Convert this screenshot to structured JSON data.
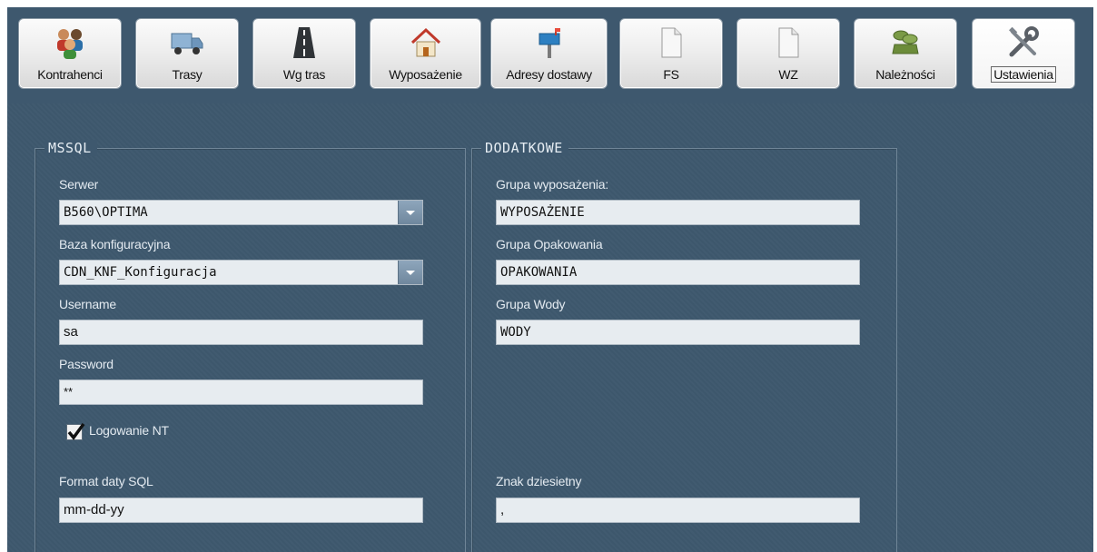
{
  "toolbar": {
    "buttons": [
      {
        "label": "Kontrahenci",
        "icon": "people-icon"
      },
      {
        "label": "Trasy",
        "icon": "truck-icon"
      },
      {
        "label": "Wg tras",
        "icon": "road-icon"
      },
      {
        "label": "Wyposażenie",
        "icon": "house-icon"
      },
      {
        "label": "Adresy dostawy",
        "icon": "mailbox-icon"
      },
      {
        "label": "FS",
        "icon": "document-icon"
      },
      {
        "label": "WZ",
        "icon": "document-icon"
      },
      {
        "label": "Należności",
        "icon": "money-icon"
      },
      {
        "label": "Ustawienia",
        "icon": "tools-icon"
      }
    ],
    "active": "Ustawienia"
  },
  "mssql": {
    "legend": "MSSQL",
    "server_label": "Serwer",
    "server_value": "B560\\OPTIMA",
    "config_db_label": "Baza konfiguracyjna",
    "config_db_value": "CDN_KNF_Konfiguracja",
    "username_label": "Username",
    "username_value": "sa",
    "password_label": "Password",
    "password_value": "**",
    "nt_login_label": "Logowanie NT",
    "nt_login_checked": true,
    "date_format_label": "Format daty SQL",
    "date_format_value": "mm-dd-yy"
  },
  "extra": {
    "legend": "DODATKOWE",
    "equipment_group_label": "Grupa wyposażenia:",
    "equipment_group_value": "WYPOSAŻENIE",
    "packaging_group_label": "Grupa Opakowania",
    "packaging_group_value": "OPAKOWANIA",
    "water_group_label": "Grupa Wody",
    "water_group_value": "WODY",
    "decimal_sign_label": "Znak dziesietny",
    "decimal_sign_value": ","
  },
  "colors": {
    "background": "#3e586e",
    "field_bg": "#e7ecf0",
    "dropdown_button": "#7e96ac"
  }
}
